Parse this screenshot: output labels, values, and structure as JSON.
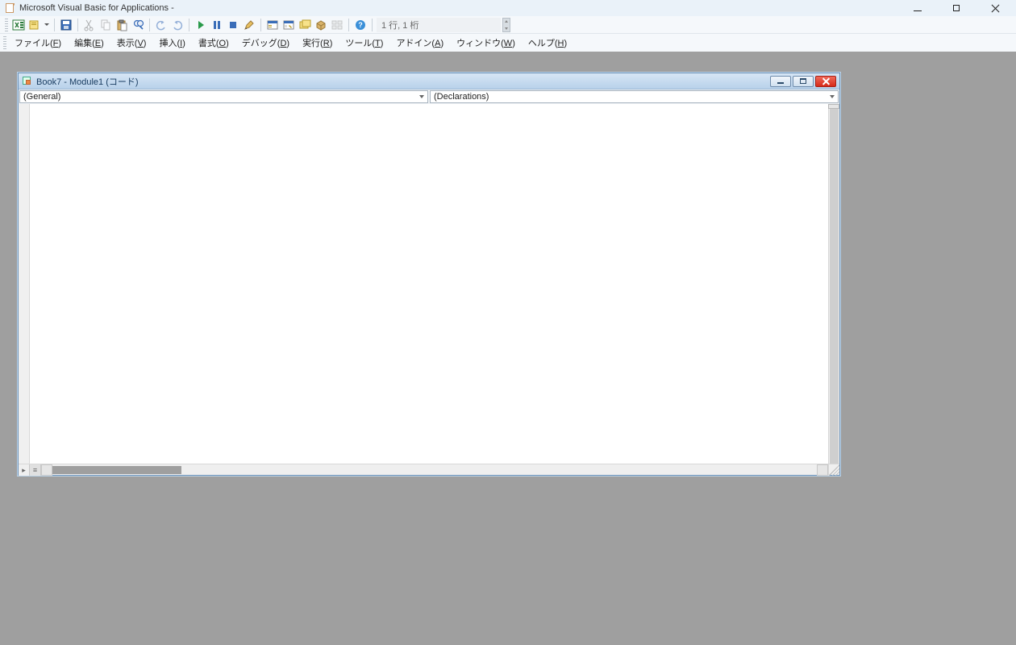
{
  "app": {
    "title_prefix": "Microsoft Visual Basic for Applications - ",
    "title_doc": ""
  },
  "toolbar": {
    "position": "1 行, 1 桁"
  },
  "menu": {
    "file": "ファイル(<u>F</u>)",
    "edit": "編集(<u>E</u>)",
    "view": "表示(<u>V</u>)",
    "insert": "挿入(<u>I</u>)",
    "format": "書式(<u>O</u>)",
    "debug": "デバッグ(<u>D</u>)",
    "run": "実行(<u>R</u>)",
    "tools": "ツール(<u>T</u>)",
    "addins": "アドイン(<u>A</u>)",
    "window": "ウィンドウ(<u>W</u>)",
    "help": "ヘルプ(<u>H</u>)"
  },
  "codewin": {
    "title": "Book7 - Module1 (コード)",
    "object_dd": "(General)",
    "proc_dd": "(Declarations)"
  }
}
